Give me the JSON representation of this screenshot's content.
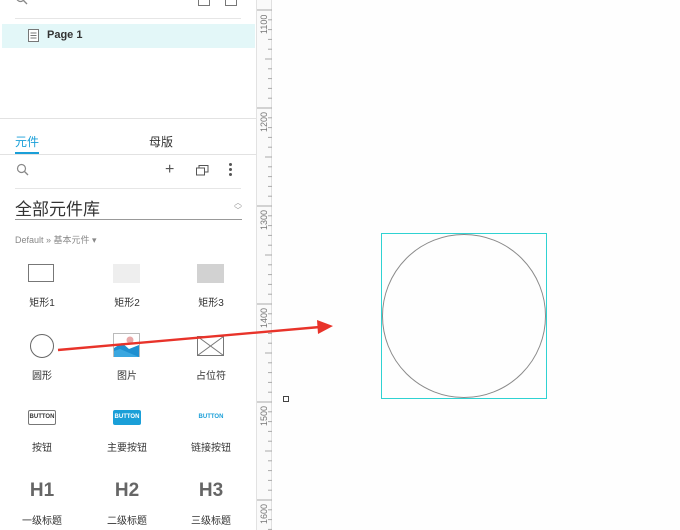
{
  "pages": {
    "items": [
      {
        "label": "Page 1"
      }
    ]
  },
  "library": {
    "tabs": [
      {
        "label": "元件"
      },
      {
        "label": "母版"
      }
    ],
    "add_symbol": "+",
    "selected_library": "全部元件库",
    "breadcrumb": "Default » 基本元件 ▾",
    "widgets": [
      {
        "label": "矩形1",
        "icon": "rectangle-outline-icon"
      },
      {
        "label": "矩形2",
        "icon": "rectangle-light-fill-icon"
      },
      {
        "label": "矩形3",
        "icon": "rectangle-gray-fill-icon"
      },
      {
        "label": "圆形",
        "icon": "circle-icon"
      },
      {
        "label": "图片",
        "icon": "image-icon"
      },
      {
        "label": "占位符",
        "icon": "placeholder-icon"
      },
      {
        "label": "按钮",
        "icon_text": "BUTTON"
      },
      {
        "label": "主要按钮",
        "icon_text": "BUTTON"
      },
      {
        "label": "链接按钮",
        "icon_text": "BUTTON"
      },
      {
        "label": "一级标题",
        "icon_text": "H1"
      },
      {
        "label": "二级标题",
        "icon_text": "H2"
      },
      {
        "label": "三级标题",
        "icon_text": "H3"
      }
    ]
  },
  "ruler": {
    "labels": [
      "1100",
      "1200",
      "1300",
      "1400",
      "1500",
      "1600"
    ]
  },
  "colors": {
    "accent": "#1a9fd8",
    "selection": "#2fd2d2",
    "annotation_arrow": "#e8332a",
    "page_highlight": "#e3f7f8"
  }
}
